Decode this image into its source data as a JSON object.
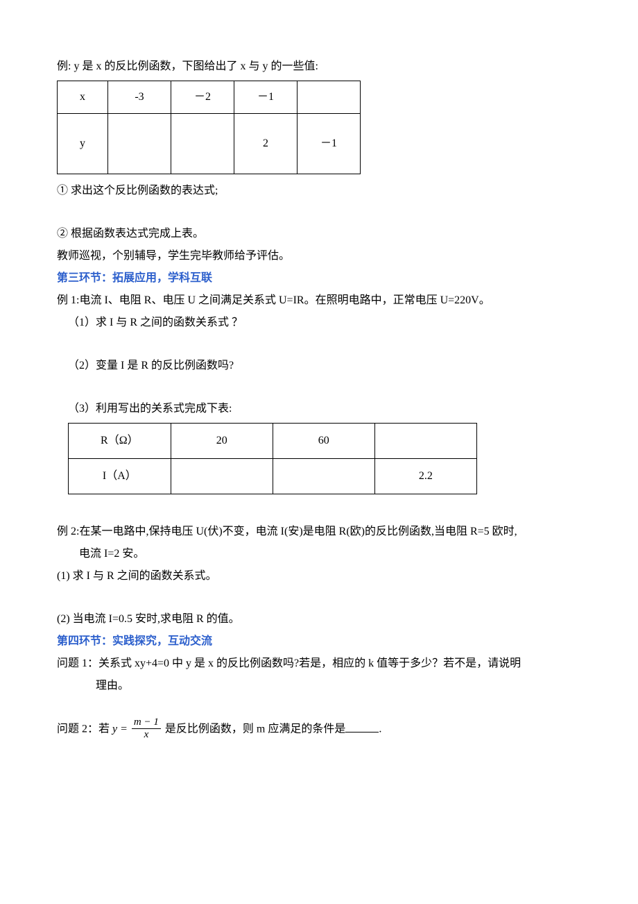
{
  "intro": "例:  y 是 x 的反比例函数，下图给出了 x 与 y 的一些值:",
  "table1": {
    "r1": [
      "x",
      "-3",
      "－2",
      "－1",
      ""
    ],
    "r2": [
      "y",
      "",
      "",
      "2",
      "－1"
    ]
  },
  "q1": "① 求出这个反比例函数的表达式;",
  "q2": "② 根据函数表达式完成上表。",
  "note1": "教师巡视，个别辅导，学生完毕教师给予评估。",
  "section3": "第三环节：拓展应用，学科互联",
  "ex1_intro": "例 1:电流 I、电阻 R、电压 U 之间满足关系式 U=IR。在照明电路中，正常电压 U=220V。",
  "ex1_q1": "（1）求 I 与 R 之间的函数关系式 ？",
  "ex1_q2": "（2）变量 I 是 R 的反比例函数吗?",
  "ex1_q3": "（3）利用写出的关系式完成下表:",
  "table2": {
    "r1": [
      "R（Ω）",
      "20",
      "60",
      ""
    ],
    "r2": [
      "I（A）",
      "",
      "",
      "2.2"
    ]
  },
  "ex2_intro": "例 2:在某一电路中,保持电压 U(伏)不变，电流 I(安)是电阻 R(欧)的反比例函数,当电阻 R=5 欧时,",
  "ex2_intro_line2": "电流 I=2 安。",
  "ex2_q1": "(1) 求 I 与 R 之间的函数关系式。",
  "ex2_q2": "(2) 当电流 I=0.5 安时,求电阻 R 的值。",
  "section4": "第四环节：实践探究，互动交流",
  "p1_line1": "问题 1：关系式 xy+4=0 中 y 是 x 的反比例函数吗?若是，相应的 k 值等于多少？若不是，请说明",
  "p1_line2": "理由。",
  "p2_prefix": "问题 2：若 ",
  "p2_mid": " 是反比例函数，则 m 应满足的条件是",
  "p2_suffix": ".",
  "frac": {
    "eq": "y =",
    "num": "m − 1",
    "den": "x"
  }
}
